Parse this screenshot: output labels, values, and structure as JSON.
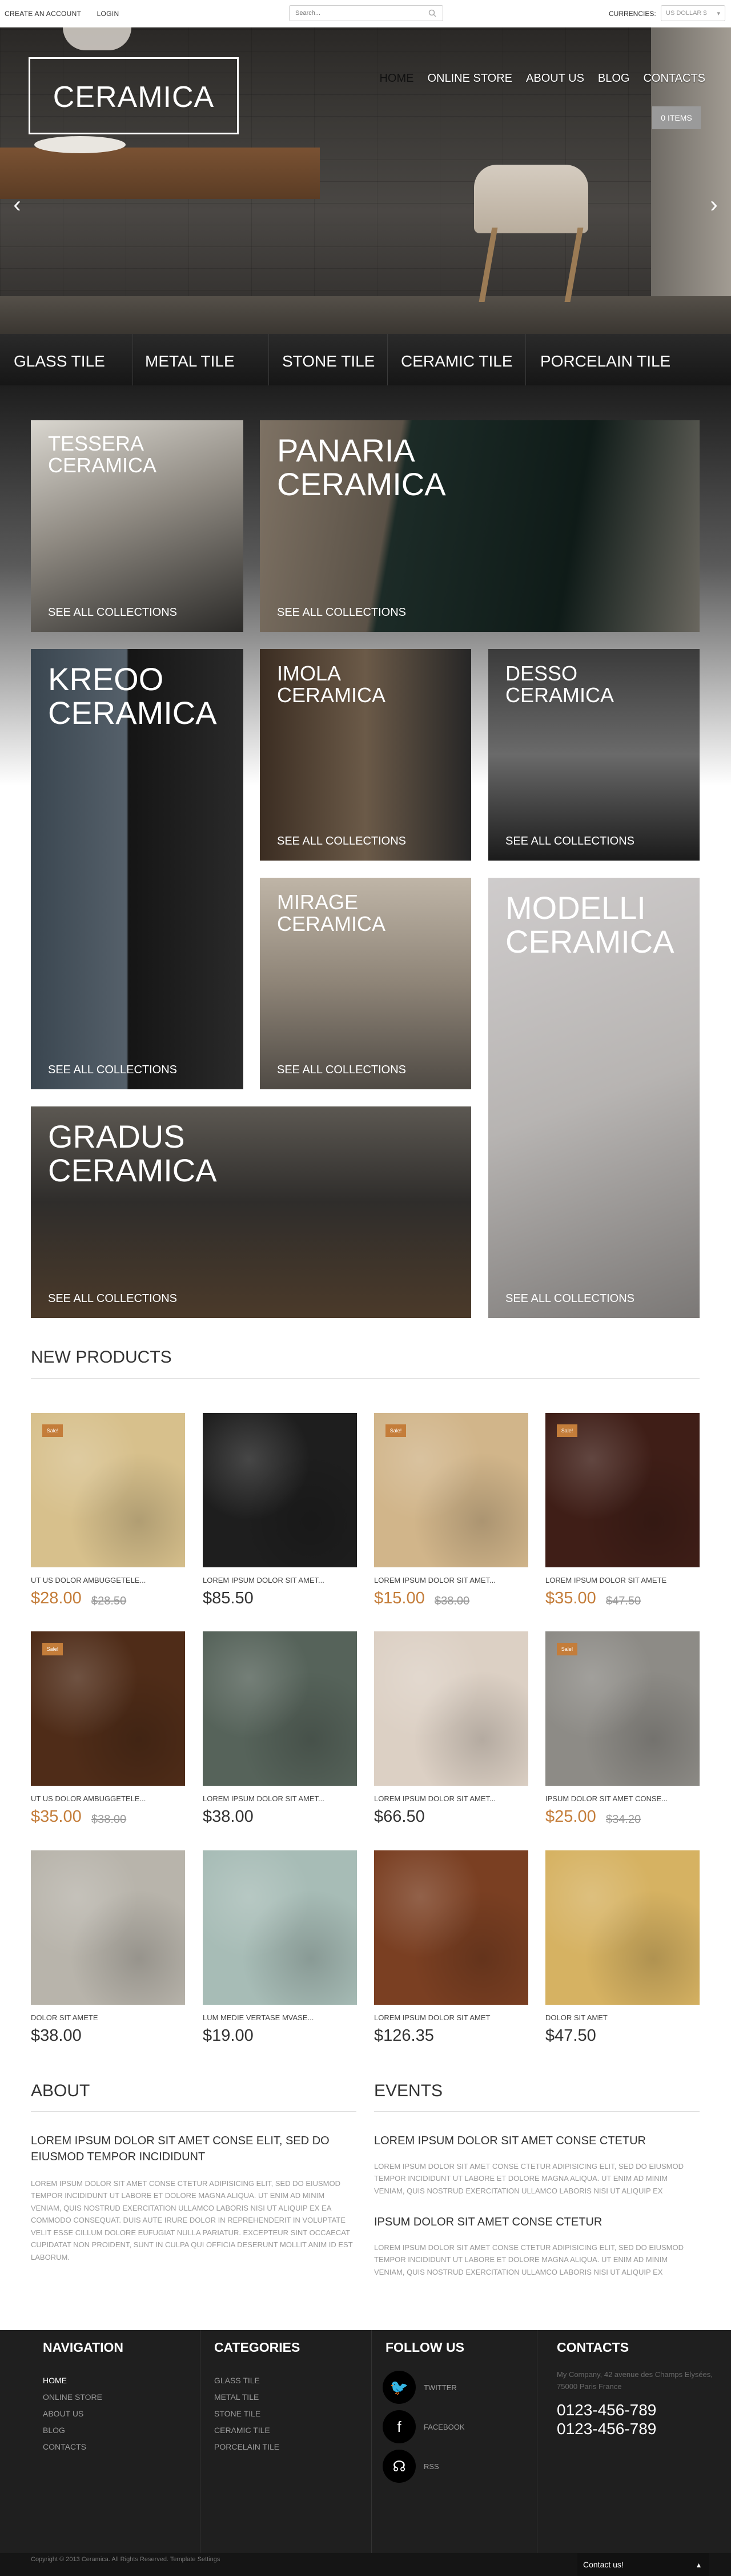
{
  "topbar": {
    "create_account": "CREATE AN ACCOUNT",
    "login": "LOGIN",
    "search_placeholder": "Search...",
    "currencies_label": "CURRENCIES:",
    "currency_value": "US DOLLAR $"
  },
  "header": {
    "logo": "CERAMICA",
    "nav": [
      "HOME",
      "ONLINE STORE",
      "ABOUT US",
      "BLOG",
      "CONTACTS"
    ],
    "cart": "0 ITEMS",
    "prev_arrow": "‹",
    "next_arrow": "›"
  },
  "categories": [
    "GLASS TILE",
    "METAL TILE",
    "STONE TILE",
    "CERAMIC TILE",
    "PORCELAIN TILE"
  ],
  "collections": {
    "cta": "SEE ALL COLLECTIONS",
    "items": [
      {
        "name1": "TESSERA",
        "name2": "CERAMICA"
      },
      {
        "name1": "PANARIA",
        "name2": "CERAMICA"
      },
      {
        "name1": "KREOO",
        "name2": "CERAMICA"
      },
      {
        "name1": "IMOLA",
        "name2": "CERAMICA"
      },
      {
        "name1": "DESSO",
        "name2": "CERAMICA"
      },
      {
        "name1": "MIRAGE",
        "name2": "CERAMICA"
      },
      {
        "name1": "MODELLI",
        "name2": "CERAMICA"
      },
      {
        "name1": "GRADUS",
        "name2": "CERAMICA"
      }
    ]
  },
  "new_products": {
    "title": "NEW PRODUCTS",
    "sale_badge": "Sale!",
    "items": [
      {
        "name": "UT US DOLOR AMBUGGETELE...",
        "price": "$28.00",
        "old": "$28.50",
        "sale": true,
        "color": "#d7c08c"
      },
      {
        "name": "LOREM IPSUM DOLOR SIT AMET...",
        "price": "$85.50",
        "old": "",
        "sale": false,
        "color": "#1e1e1e"
      },
      {
        "name": "LOREM IPSUM DOLOR SIT AMET...",
        "price": "$15.00",
        "old": "$38.00",
        "sale": true,
        "color": "#d1b58a"
      },
      {
        "name": "LOREM IPSUM DOLOR SIT AMETE",
        "price": "$35.00",
        "old": "$47.50",
        "sale": true,
        "color": "#3f1e17"
      },
      {
        "name": "UT US DOLOR AMBUGGETELE...",
        "price": "$35.00",
        "old": "$38.00",
        "sale": true,
        "color": "#4f2c18"
      },
      {
        "name": "LOREM IPSUM DOLOR SIT AMET...",
        "price": "$38.00",
        "old": "",
        "sale": false,
        "color": "#56635a"
      },
      {
        "name": "LOREM IPSUM DOLOR SIT AMET...",
        "price": "$66.50",
        "old": "",
        "sale": false,
        "color": "#dcd0c4"
      },
      {
        "name": "IPSUM DOLOR SIT AMET CONSE...",
        "price": "$25.00",
        "old": "$34.20",
        "sale": true,
        "color": "#8d8b86"
      },
      {
        "name": "DOLOR SIT AMETE",
        "price": "$38.00",
        "old": "",
        "sale": false,
        "color": "#b8b4ab"
      },
      {
        "name": "LUM MEDIE VERTASE MVASE...",
        "price": "$19.00",
        "old": "",
        "sale": false,
        "color": "#a7bcb6"
      },
      {
        "name": "LOREM IPSUM DOLOR SIT AMET",
        "price": "$126.35",
        "old": "",
        "sale": false,
        "color": "#7a3f22"
      },
      {
        "name": "DOLOR SIT AMET",
        "price": "$47.50",
        "old": "",
        "sale": false,
        "color": "#d6b262"
      }
    ]
  },
  "about": {
    "title": "ABOUT",
    "heading": "LOREM IPSUM DOLOR SIT AMET CONSE ELIT, SED DO EIUSMOD TEMPOR INCIDIDUNT",
    "text": "LOREM IPSUM DOLOR SIT AMET CONSE CTETUR ADIPISICING ELIT, SED DO EIUSMOD TEMPOR INCIDIDUNT UT LABORE ET DOLORE MAGNA ALIQUA. UT ENIM AD MINIM VENIAM, QUIS NOSTRUD EXERCITATION ULLAMCO LABORIS NISI UT ALIQUIP EX EA COMMODO CONSEQUAT. DUIS AUTE IRURE DOLOR IN REPREHENDERIT IN VOLUPTATE VELIT ESSE CILLUM DOLORE EUFUGIAT NULLA PARIATUR. EXCEPTEUR SINT OCCAECAT CUPIDATAT NON PROIDENT, SUNT IN CULPA QUI OFFICIA DESERUNT MOLLIT ANIM ID EST LABORUM."
  },
  "events": {
    "title": "EVENTS",
    "items": [
      {
        "heading": "LOREM IPSUM DOLOR SIT AMET CONSE CTETUR",
        "text": "LOREM IPSUM DOLOR SIT AMET CONSE CTETUR ADIPISICING ELIT, SED DO EIUSMOD TEMPOR INCIDIDUNT UT LABORE ET DOLORE MAGNA ALIQUA. UT ENIM AD MINIM VENIAM, QUIS NOSTRUD EXERCITATION ULLAMCO LABORIS NISI UT ALIQUIP EX"
      },
      {
        "heading": "IPSUM DOLOR SIT AMET CONSE CTETUR",
        "text": "LOREM IPSUM DOLOR SIT AMET CONSE CTETUR ADIPISICING ELIT, SED DO EIUSMOD TEMPOR INCIDIDUNT UT LABORE ET DOLORE MAGNA ALIQUA. UT ENIM AD MINIM VENIAM, QUIS NOSTRUD EXERCITATION ULLAMCO LABORIS NISI UT ALIQUIP EX"
      }
    ]
  },
  "footer": {
    "navigation": {
      "title": "NAVIGATION",
      "items": [
        "HOME",
        "ONLINE STORE",
        "ABOUT US",
        "BLOG",
        "CONTACTS"
      ]
    },
    "categories": {
      "title": "CATEGORIES",
      "items": [
        "GLASS TILE",
        "METAL TILE",
        "STONE TILE",
        "CERAMIC TILE",
        "PORCELAIN TILE"
      ]
    },
    "follow": {
      "title": "FOLLOW US",
      "items": [
        {
          "label": "TWITTER",
          "icon": "twitter-icon",
          "glyph": "🐦"
        },
        {
          "label": "FACEBOOK",
          "icon": "facebook-icon",
          "glyph": "f"
        },
        {
          "label": "RSS",
          "icon": "rss-icon",
          "glyph": "☊"
        }
      ]
    },
    "contacts": {
      "title": "CONTACTS",
      "address": "My Company, 42 avenue des Champs Elysées, 75000 Paris France",
      "phone1": "0123-456-789",
      "phone2": "0123-456-789"
    },
    "copyright": "Copyright © 2013 Ceramica. All Rights Reserved. Template Settings",
    "contact_us": "Contact us!"
  },
  "colors": {
    "accent": "#c47d3a",
    "dark": "#1f1f1f"
  }
}
